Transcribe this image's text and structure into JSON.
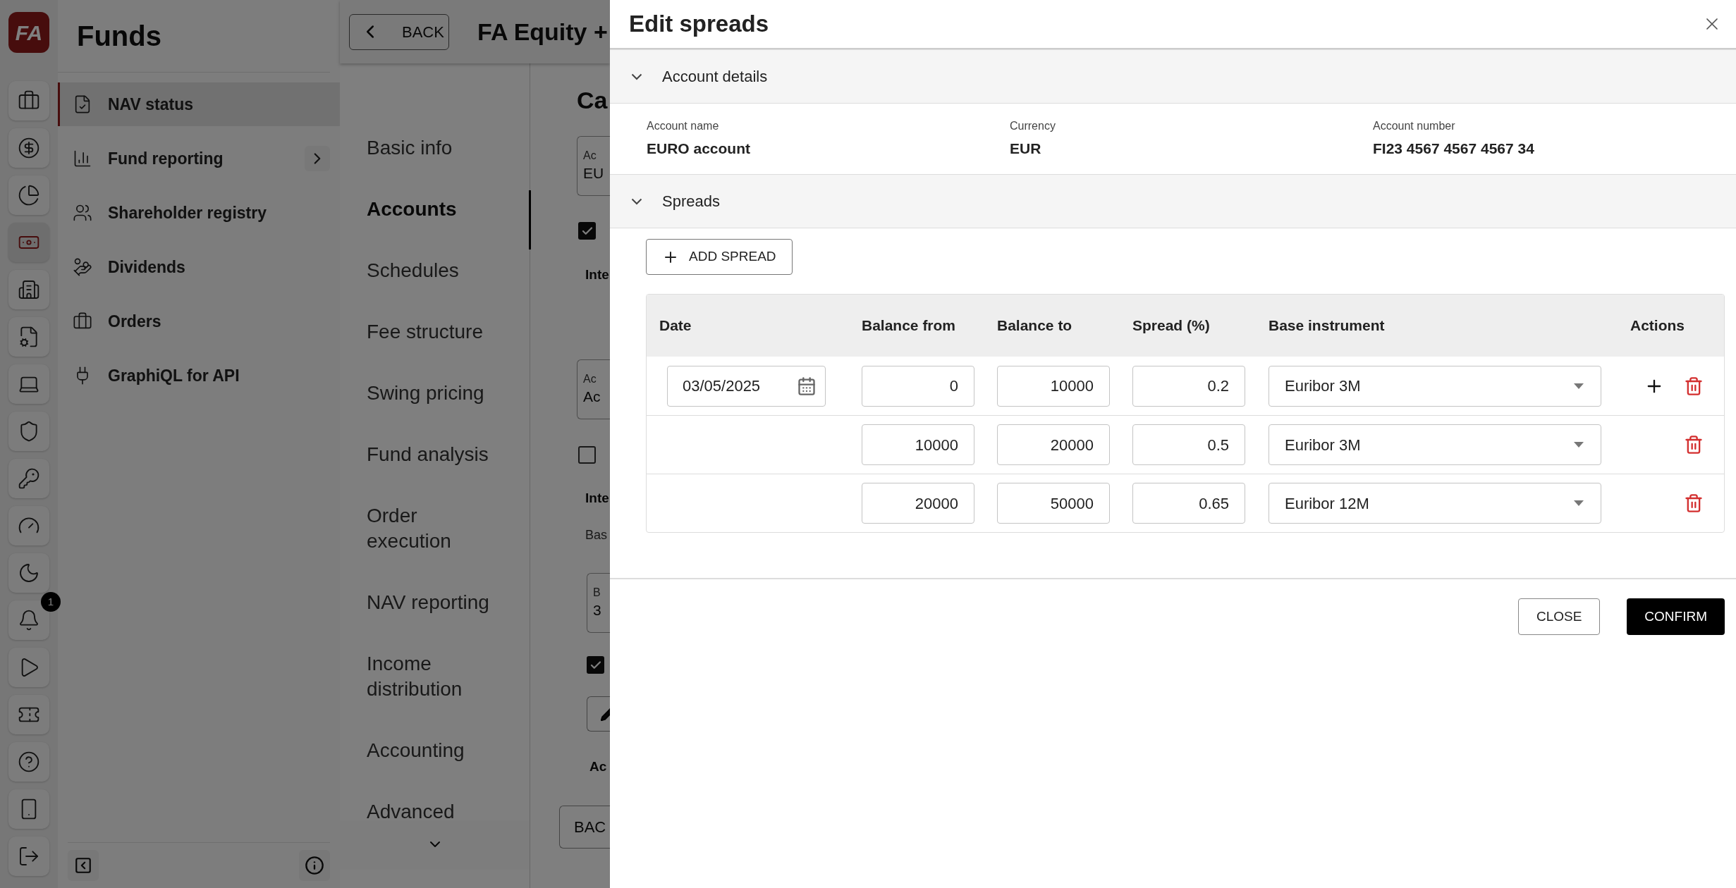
{
  "rail": {
    "logo": "FA",
    "items": [
      {
        "selected": false
      },
      {
        "selected": false
      },
      {
        "selected": false
      },
      {
        "selected": true
      },
      {
        "selected": false
      },
      {
        "selected": false
      },
      {
        "selected": false
      },
      {
        "selected": false
      },
      {
        "selected": false
      },
      {
        "selected": false
      },
      {
        "selected": false
      },
      {
        "selected": false,
        "badge": "1"
      },
      {
        "selected": false
      },
      {
        "selected": false
      },
      {
        "selected": false
      },
      {
        "selected": false
      },
      {
        "selected": false
      }
    ]
  },
  "nav": {
    "title": "Funds",
    "items": [
      {
        "label": "NAV status",
        "selected": true,
        "has_submenu": false
      },
      {
        "label": "Fund reporting",
        "selected": false,
        "has_submenu": true
      },
      {
        "label": "Shareholder registry",
        "selected": false,
        "has_submenu": false
      },
      {
        "label": "Dividends",
        "selected": false,
        "has_submenu": false
      },
      {
        "label": "Orders",
        "selected": false,
        "has_submenu": false
      },
      {
        "label": "GraphiQL for API",
        "selected": false,
        "has_submenu": false
      }
    ]
  },
  "header": {
    "back": "BACK",
    "title": "FA Equity +"
  },
  "subnav": {
    "items": [
      {
        "label": "Basic info",
        "selected": false
      },
      {
        "label": "Accounts",
        "selected": true
      },
      {
        "label": "Schedules",
        "selected": false
      },
      {
        "label": "Fee structure",
        "selected": false
      },
      {
        "label": "Swing pricing",
        "selected": false
      },
      {
        "label": "Fund analysis",
        "selected": false
      },
      {
        "label": "Order execution",
        "selected": false
      },
      {
        "label": "NAV reporting",
        "selected": false
      },
      {
        "label": "Income distribution",
        "selected": false
      },
      {
        "label": "Accounting",
        "selected": false
      },
      {
        "label": "Advanced",
        "selected": false
      }
    ]
  },
  "content": [
    {
      "kind": "heading",
      "text": "Ca"
    },
    {
      "kind": "field",
      "label": "Ac",
      "value": "EU"
    },
    {
      "kind": "checkbox",
      "checked": true
    },
    {
      "kind": "subheading",
      "text": "Inte"
    },
    {
      "kind": "field",
      "label": "Ac",
      "value": "Ac"
    },
    {
      "kind": "checkbox",
      "checked": false
    },
    {
      "kind": "subheading",
      "text": "Inte"
    },
    {
      "kind": "text",
      "text": "Bas"
    },
    {
      "kind": "field",
      "label": "B",
      "value": "3"
    },
    {
      "kind": "checkbox",
      "checked": true
    },
    {
      "kind": "edit-button"
    },
    {
      "kind": "subheading",
      "text": "Ac"
    },
    {
      "kind": "button",
      "text": "BAC"
    }
  ],
  "dialog": {
    "title": "Edit spreads",
    "account_section": {
      "title": "Account details",
      "expanded": true,
      "fields": [
        {
          "label": "Account name",
          "value": "EURO account"
        },
        {
          "label": "Currency",
          "value": "EUR"
        },
        {
          "label": "Account number",
          "value": "FI23 4567 4567 4567 34"
        }
      ]
    },
    "spreads_section": {
      "title": "Spreads",
      "expanded": true,
      "add_button": "ADD SPREAD",
      "columns": [
        "Date",
        "Balance from",
        "Balance to",
        "Spread (%)",
        "Base instrument",
        "Actions"
      ],
      "rows": [
        {
          "date": "03/05/2025",
          "balance_from": "0",
          "balance_to": "10000",
          "spread": "0.2",
          "base_instrument": "Euribor 3M",
          "can_add": true
        },
        {
          "balance_from": "10000",
          "balance_to": "20000",
          "spread": "0.5",
          "base_instrument": "Euribor 3M",
          "can_add": false
        },
        {
          "balance_from": "20000",
          "balance_to": "50000",
          "spread": "0.65",
          "base_instrument": "Euribor 12M",
          "can_add": false
        }
      ]
    },
    "buttons": [
      {
        "kind": "secondary",
        "label": "CLOSE"
      },
      {
        "kind": "primary",
        "label": "CONFIRM"
      }
    ]
  }
}
